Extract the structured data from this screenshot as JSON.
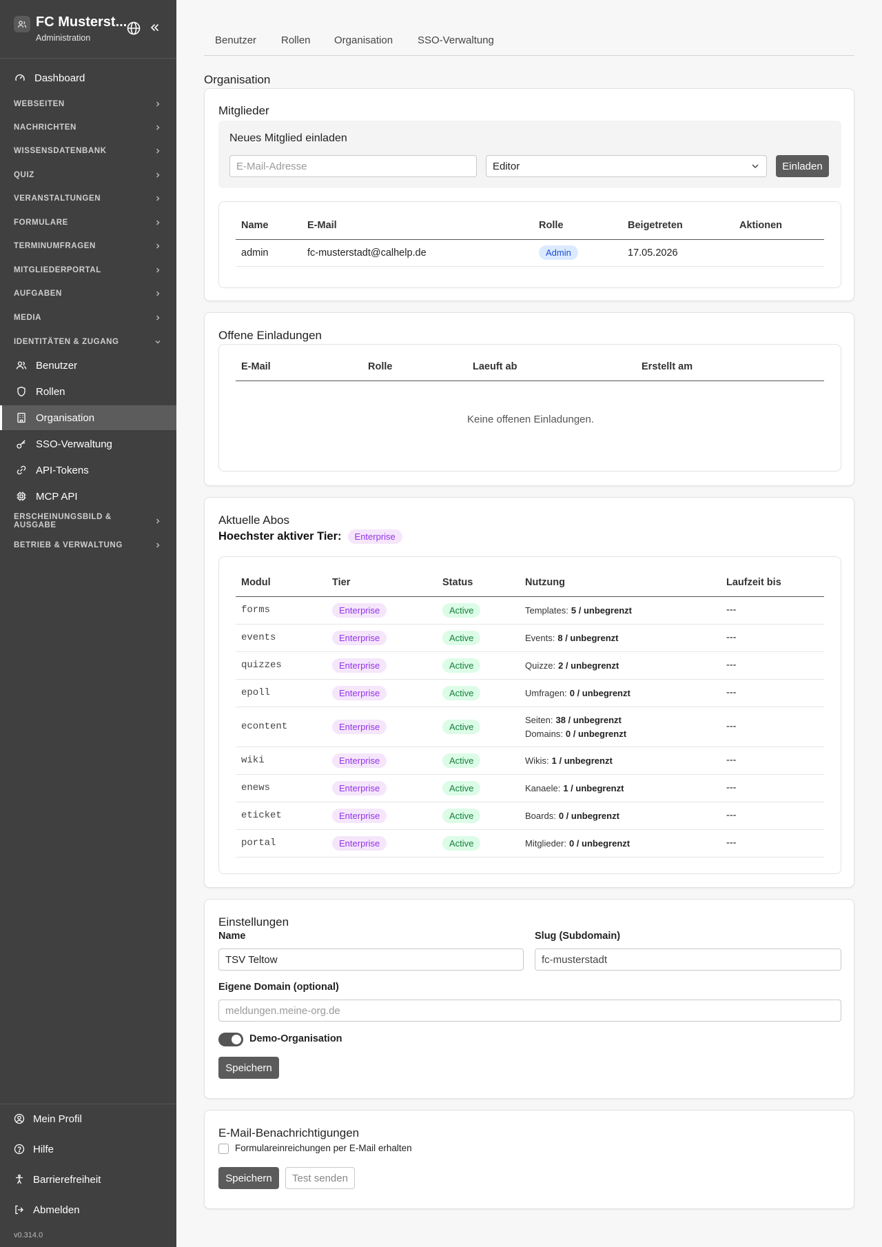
{
  "sidebar": {
    "org_name": "FC Musterst...",
    "subtitle": "Administration",
    "dashboard": "Dashboard",
    "sections": [
      "Webseiten",
      "Nachrichten",
      "Wissensdatenbank",
      "Quiz",
      "Veranstaltungen",
      "Formulare",
      "Terminumfragen",
      "Mitgliederportal",
      "Aufgaben",
      "Media",
      "Identitäten & Zugang"
    ],
    "sub_items": [
      "Benutzer",
      "Rollen",
      "Organisation",
      "SSO-Verwaltung",
      "API-Tokens",
      "MCP API"
    ],
    "sections_after": [
      "Erscheinungsbild & Ausgabe",
      "Betrieb & Verwaltung"
    ],
    "bottom": [
      "Mein Profil",
      "Hilfe",
      "Barrierefreiheit",
      "Abmelden"
    ],
    "version": "v0.314.0"
  },
  "tabs": [
    "Benutzer",
    "Rollen",
    "Organisation",
    "SSO-Verwaltung"
  ],
  "page_title": "Organisation",
  "members": {
    "title": "Mitglieder",
    "invite_title": "Neues Mitglied einladen",
    "email_placeholder": "E-Mail-Adresse",
    "role_value": "Editor",
    "invite_button": "Einladen",
    "columns": [
      "Name",
      "E-Mail",
      "Rolle",
      "Beigetreten",
      "Aktionen"
    ],
    "rows": [
      {
        "name": "admin",
        "email": "fc-musterstadt@calhelp.de",
        "role": "Admin",
        "joined": "17.05.2026"
      }
    ]
  },
  "invitations": {
    "title": "Offene Einladungen",
    "columns": [
      "E-Mail",
      "Rolle",
      "Laeuft ab",
      "Erstellt am"
    ],
    "empty": "Keine offenen Einladungen."
  },
  "subscriptions": {
    "title": "Aktuelle Abos",
    "tier_label": "Hoechster aktiver Tier:",
    "tier_value": "Enterprise",
    "columns": [
      "Modul",
      "Tier",
      "Status",
      "Nutzung",
      "Laufzeit bis"
    ],
    "rows": [
      {
        "module": "forms",
        "tier": "Enterprise",
        "status": "Active",
        "usage": [
          {
            "label": "Templates:",
            "value": "5 / unbegrenzt"
          }
        ],
        "until": "---"
      },
      {
        "module": "events",
        "tier": "Enterprise",
        "status": "Active",
        "usage": [
          {
            "label": "Events:",
            "value": "8 / unbegrenzt"
          }
        ],
        "until": "---"
      },
      {
        "module": "quizzes",
        "tier": "Enterprise",
        "status": "Active",
        "usage": [
          {
            "label": "Quizze:",
            "value": "2 / unbegrenzt"
          }
        ],
        "until": "---"
      },
      {
        "module": "epoll",
        "tier": "Enterprise",
        "status": "Active",
        "usage": [
          {
            "label": "Umfragen:",
            "value": "0 / unbegrenzt"
          }
        ],
        "until": "---"
      },
      {
        "module": "econtent",
        "tier": "Enterprise",
        "status": "Active",
        "usage": [
          {
            "label": "Seiten:",
            "value": "38 / unbegrenzt"
          },
          {
            "label": "Domains:",
            "value": "0 / unbegrenzt"
          }
        ],
        "until": "---"
      },
      {
        "module": "wiki",
        "tier": "Enterprise",
        "status": "Active",
        "usage": [
          {
            "label": "Wikis:",
            "value": "1 / unbegrenzt"
          }
        ],
        "until": "---"
      },
      {
        "module": "enews",
        "tier": "Enterprise",
        "status": "Active",
        "usage": [
          {
            "label": "Kanaele:",
            "value": "1 / unbegrenzt"
          }
        ],
        "until": "---"
      },
      {
        "module": "eticket",
        "tier": "Enterprise",
        "status": "Active",
        "usage": [
          {
            "label": "Boards:",
            "value": "0 / unbegrenzt"
          }
        ],
        "until": "---"
      },
      {
        "module": "portal",
        "tier": "Enterprise",
        "status": "Active",
        "usage": [
          {
            "label": "Mitglieder:",
            "value": "0 / unbegrenzt"
          }
        ],
        "until": "---"
      }
    ]
  },
  "settings": {
    "title": "Einstellungen",
    "name_label": "Name",
    "name_value": "TSV Teltow",
    "slug_label": "Slug (Subdomain)",
    "slug_value": "fc-musterstadt",
    "domain_label": "Eigene Domain (optional)",
    "domain_placeholder": "meldungen.meine-org.de",
    "demo_label": "Demo-Organisation",
    "demo_on": true,
    "save": "Speichern"
  },
  "notifications": {
    "title": "E-Mail-Benachrichtigungen",
    "checkbox_label": "Formulareinreichungen per E-Mail erhalten",
    "save": "Speichern",
    "test": "Test senden"
  }
}
